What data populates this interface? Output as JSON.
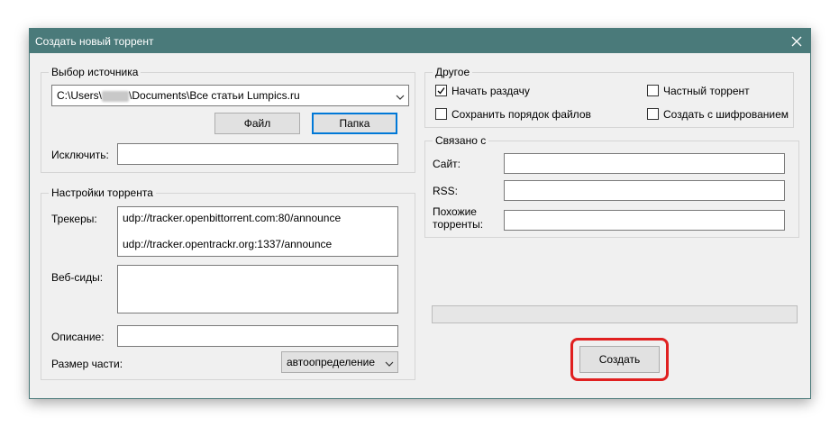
{
  "window": {
    "title": "Создать новый торрент"
  },
  "source": {
    "group_label": "Выбор источника",
    "path_prefix": "C:\\Users\\",
    "path_suffix": "\\Documents\\Все статьи Lumpics.ru",
    "file_button": "Файл",
    "folder_button": "Папка",
    "exclude_label": "Исключить:",
    "exclude_value": ""
  },
  "settings": {
    "group_label": "Настройки торрента",
    "trackers_label": "Трекеры:",
    "trackers": [
      "udp://tracker.openbittorrent.com:80/announce",
      "udp://tracker.opentrackr.org:1337/announce"
    ],
    "webseeds_label": "Веб-сиды:",
    "webseeds_value": "",
    "description_label": "Описание:",
    "description_value": "",
    "piece_size_label": "Размер части:",
    "piece_size_value": "автоопределение"
  },
  "other": {
    "group_label": "Другое",
    "start_seeding": {
      "label": "Начать раздачу",
      "checked": true
    },
    "private": {
      "label": "Частный торрент",
      "checked": false
    },
    "keep_order": {
      "label": "Сохранить порядок файлов",
      "checked": false
    },
    "encrypt": {
      "label": "Создать с шифрованием",
      "checked": false
    }
  },
  "related": {
    "group_label": "Связано с",
    "site_label": "Сайт:",
    "site_value": "",
    "rss_label": "RSS:",
    "rss_value": "",
    "similar_label_line1": "Похожие",
    "similar_label_line2": "торренты:",
    "similar_value": ""
  },
  "progress": {
    "value": 0
  },
  "create_button": "Создать",
  "colors": {
    "titlebar": "#4a7a7a",
    "highlight": "#e02020",
    "focus": "#0078d7"
  },
  "icons": {
    "close": "close-icon",
    "dropdown": "chevron-down-icon",
    "check": "checkmark-icon"
  }
}
